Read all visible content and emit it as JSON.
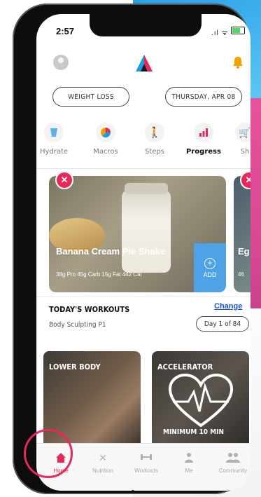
{
  "status": {
    "time": "2:57"
  },
  "header": {
    "logo": "A"
  },
  "pills": {
    "goal": "WEIGHT LOSS",
    "date": "THURSDAY, APR 08"
  },
  "nav": [
    {
      "label": "Hydrate",
      "icon": "glass-icon"
    },
    {
      "label": "Macros",
      "icon": "pie-chart-icon"
    },
    {
      "label": "Steps",
      "icon": "walking-icon"
    },
    {
      "label": "Progress",
      "icon": "bar-chart-icon",
      "active": true
    },
    {
      "label": "Sh",
      "icon": "cart-icon"
    }
  ],
  "recipe_card": {
    "title": "Banana Cream Pie Shake",
    "macros": "38g Pro   45g Carb   15g Fat   442 Cal",
    "add_label": "ADD"
  },
  "recipe_card_next": {
    "title": "Eg",
    "macros": "46"
  },
  "workouts": {
    "heading": "TODAY'S WORKOUTS",
    "change": "Change",
    "program": "Body Sculpting P1",
    "day": "Day 1 of 84",
    "cards": [
      {
        "title": "LOWER BODY",
        "subtitle": ""
      },
      {
        "title": "ACCELERATOR",
        "subtitle": "MINIMUM 10 MIN"
      }
    ]
  },
  "tabbar": [
    {
      "label": "Home",
      "icon": "home-icon",
      "active": true
    },
    {
      "label": "Nutrition",
      "icon": "utensils-icon"
    },
    {
      "label": "Workouts",
      "icon": "dumbbell-icon"
    },
    {
      "label": "Me",
      "icon": "person-icon"
    },
    {
      "label": "Community",
      "icon": "people-icon"
    }
  ],
  "colors": {
    "accent": "#e8275a",
    "add": "#4da3e6",
    "link": "#1d4fd8",
    "bell": "#f4a100"
  }
}
